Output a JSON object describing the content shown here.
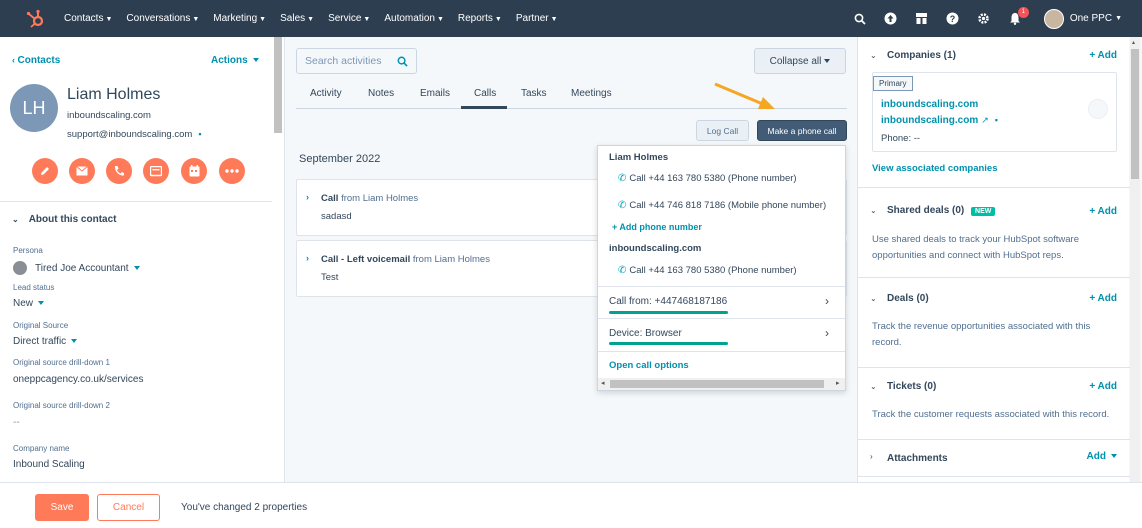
{
  "nav": {
    "items": [
      "Contacts",
      "Conversations",
      "Marketing",
      "Sales",
      "Service",
      "Automation",
      "Reports",
      "Partner"
    ],
    "notification_count": "1",
    "account_name": "One PPC"
  },
  "contact": {
    "back_label": "Contacts",
    "actions_label": "Actions",
    "initials": "LH",
    "name": "Liam Holmes",
    "domain": "inboundscaling.com",
    "email": "support@inboundscaling.com",
    "about_title": "About this contact",
    "properties": [
      {
        "label": "Persona",
        "value": "Tired Joe Accountant"
      },
      {
        "label": "Lead status",
        "value": "New"
      },
      {
        "label": "Original Source",
        "value": "Direct traffic"
      },
      {
        "label": "Original source drill-down 1",
        "value": "oneppcagency.co.uk/services"
      },
      {
        "label": "Original source drill-down 2",
        "value": "--"
      },
      {
        "label": "Company name",
        "value": "Inbound Scaling"
      }
    ]
  },
  "activity": {
    "search_placeholder": "Search activities",
    "collapse_label": "Collapse all",
    "tabs": [
      "Activity",
      "Notes",
      "Emails",
      "Calls",
      "Tasks",
      "Meetings"
    ],
    "active_tab": "Calls",
    "log_call": "Log Call",
    "make_call": "Make a phone call",
    "month": "September 2022",
    "items": [
      {
        "title": "Call",
        "from": "from Liam Holmes",
        "body": "sadasd"
      },
      {
        "title": "Call - Left voicemail",
        "from": "from Liam Holmes",
        "body": "Test"
      }
    ]
  },
  "dropdown": {
    "contact_name": "Liam Holmes",
    "phone1": "Call +44 163 780 5380 (Phone number)",
    "phone2": "Call +44 746 818 7186 (Mobile phone number)",
    "add_phone": "+ Add phone number",
    "company": "inboundscaling.com",
    "company_phone": "Call +44 163 780 5380 (Phone number)",
    "call_from": "Call from: +447468187186",
    "device": "Device: Browser",
    "open_options": "Open call options"
  },
  "sidebar": {
    "companies_title": "Companies (1)",
    "add": "+ Add",
    "primary_badge": "Primary",
    "company_link1": "inboundscaling.com",
    "company_link2": "inboundscaling.com",
    "company_phone": "Phone: --",
    "view_assoc": "View associated companies",
    "deals_shared_title": "Shared deals (0)",
    "new_badge": "NEW",
    "deals_shared_desc": "Use shared deals to track your HubSpot software opportunities and connect with HubSpot reps.",
    "deals_title": "Deals (0)",
    "deals_desc": "Track the revenue opportunities associated with this record.",
    "tickets_title": "Tickets (0)",
    "tickets_desc": "Track the customer requests associated with this record.",
    "attachments_title": "Attachments",
    "attachments_add": "Add"
  },
  "bottom": {
    "save": "Save",
    "cancel": "Cancel",
    "changed": "You've changed 2 properties"
  },
  "colors": {
    "nav_bg": "#2d3e50",
    "accent": "#ff7a59",
    "link": "#0091ae",
    "underline": "#00a38d",
    "arrow": "#f5a623"
  }
}
